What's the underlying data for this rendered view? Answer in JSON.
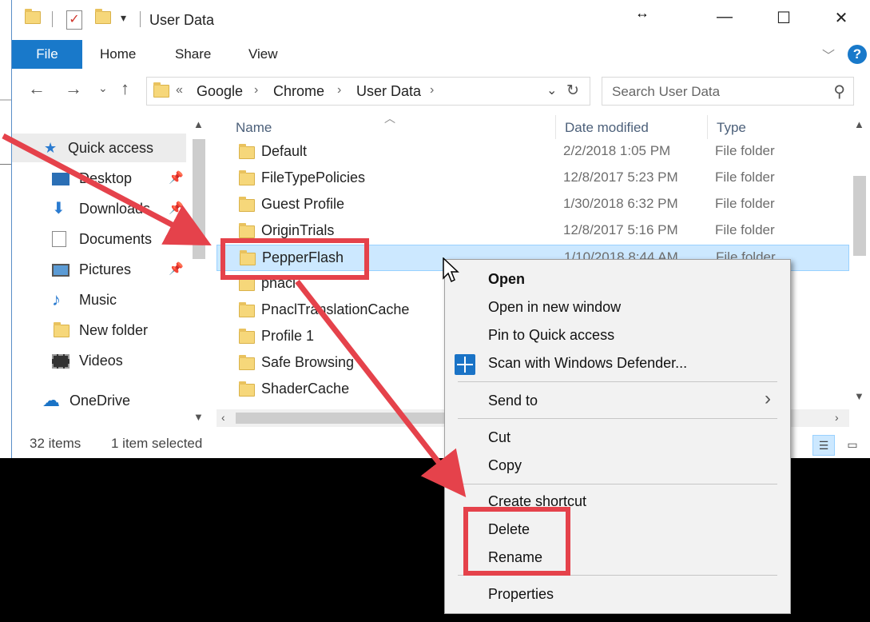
{
  "window": {
    "title": "User Data",
    "controls": {
      "minimize": "—",
      "maximize": "☐",
      "close": "✕"
    }
  },
  "ribbon": {
    "tabs": [
      "File",
      "Home",
      "Share",
      "View"
    ]
  },
  "address": {
    "prefix": "«",
    "crumbs": [
      "Google",
      "Chrome",
      "User Data"
    ]
  },
  "search": {
    "placeholder": "Search User Data"
  },
  "nav": {
    "items": [
      {
        "label": "Quick access",
        "icon": "star-icon"
      },
      {
        "label": "Desktop",
        "icon": "desktop-icon",
        "pinned": true
      },
      {
        "label": "Downloads",
        "icon": "download-icon",
        "pinned": true
      },
      {
        "label": "Documents",
        "icon": "document-icon",
        "pinned": true
      },
      {
        "label": "Pictures",
        "icon": "picture-icon",
        "pinned": true
      },
      {
        "label": "Music",
        "icon": "music-icon"
      },
      {
        "label": "New folder",
        "icon": "folder-icon"
      },
      {
        "label": "Videos",
        "icon": "video-icon"
      },
      {
        "label": "OneDrive",
        "icon": "cloud-icon"
      }
    ]
  },
  "filelist": {
    "columns": {
      "name": "Name",
      "date": "Date modified",
      "type": "Type"
    },
    "rows": [
      {
        "name": "Default",
        "date": "2/2/2018 1:05 PM",
        "type": "File folder"
      },
      {
        "name": "FileTypePolicies",
        "date": "12/8/2017 5:23 PM",
        "type": "File folder"
      },
      {
        "name": "Guest Profile",
        "date": "1/30/2018 6:32 PM",
        "type": "File folder"
      },
      {
        "name": "OriginTrials",
        "date": "12/8/2017 5:16 PM",
        "type": "File folder"
      },
      {
        "name": "PepperFlash",
        "date": "1/10/2018 8:44 AM",
        "type": "File folder",
        "selected": true
      },
      {
        "name": "pnacl",
        "date": "",
        "type": ""
      },
      {
        "name": "PnaclTranslationCache",
        "date": "",
        "type": ""
      },
      {
        "name": "Profile 1",
        "date": "",
        "type": ""
      },
      {
        "name": "Safe Browsing",
        "date": "",
        "type": ""
      },
      {
        "name": "ShaderCache",
        "date": "",
        "type": ""
      }
    ]
  },
  "status": {
    "count": "32 items",
    "selection": "1 item selected"
  },
  "context_menu": {
    "items": [
      {
        "label": "Open",
        "bold": true
      },
      {
        "label": "Open in new window"
      },
      {
        "label": "Pin to Quick access"
      },
      {
        "label": "Scan with Windows Defender..."
      },
      {
        "label": "Send to"
      },
      {
        "label": "Cut"
      },
      {
        "label": "Copy"
      },
      {
        "label": "Create shortcut"
      },
      {
        "label": "Delete"
      },
      {
        "label": "Rename"
      },
      {
        "label": "Properties"
      }
    ]
  },
  "colors": {
    "accent": "#1979ca",
    "selection": "#cce8ff",
    "annotation": "#e5424b"
  }
}
